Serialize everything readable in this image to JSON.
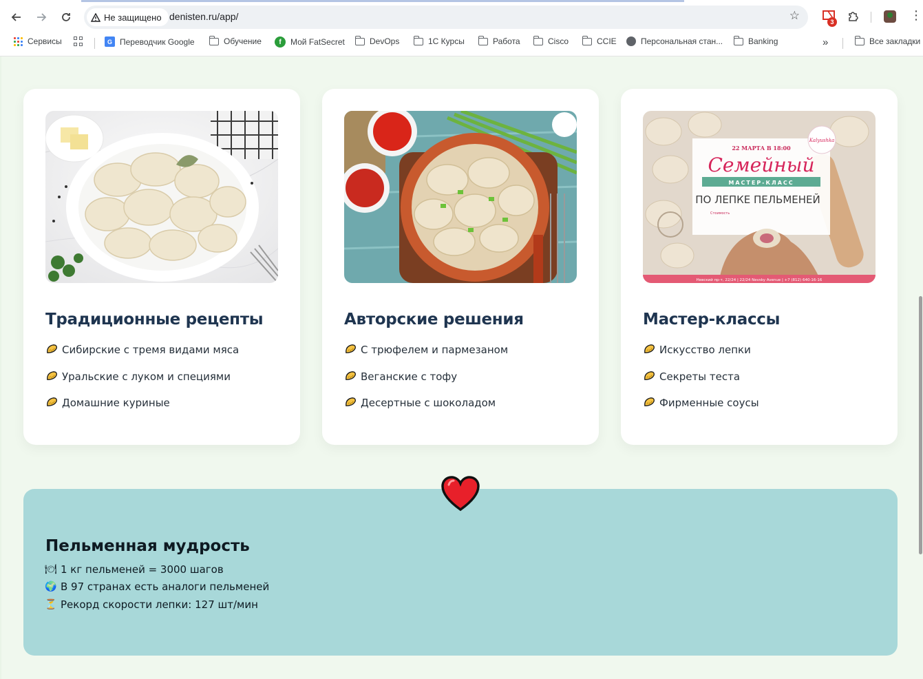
{
  "browser": {
    "security_label": "Не защищено",
    "url": "denisten.ru/app/",
    "gmail_badge": "3",
    "bookmarks": [
      {
        "label": "Сервисы",
        "icon": "apps-grid-icon"
      },
      {
        "label": "",
        "icon": "tab-groups-icon"
      },
      {
        "label": "Переводчик Google",
        "icon": "google-translate-icon"
      },
      {
        "label": "Обучение",
        "icon": "folder-icon"
      },
      {
        "label": "Мой FatSecret",
        "icon": "fatsecret-icon"
      },
      {
        "label": "DevOps",
        "icon": "folder-icon"
      },
      {
        "label": "1С Курсы",
        "icon": "folder-icon"
      },
      {
        "label": "Работа",
        "icon": "folder-icon"
      },
      {
        "label": "Cisco",
        "icon": "folder-icon"
      },
      {
        "label": "CCIE",
        "icon": "folder-icon"
      },
      {
        "label": "Персональная стан...",
        "icon": "globe-icon"
      },
      {
        "label": "Banking",
        "icon": "folder-icon"
      }
    ],
    "more_bookmarks": "»",
    "all_bookmarks": "Все закладки"
  },
  "cards": [
    {
      "title": "Традиционные рецепты",
      "image": "dumplings-plate-photo",
      "items": [
        "Сибирские с тремя видами мяса",
        "Уральские с луком и специями",
        "Домашние куриные"
      ]
    },
    {
      "title": "Авторские решения",
      "image": "dumplings-bowl-photo",
      "items": [
        "С трюфелем и пармезаном",
        "Веганские с тофу",
        "Десертные с шоколадом"
      ]
    },
    {
      "title": "Мастер-классы",
      "image": "masterclass-poster",
      "poster": {
        "date": "22 МАРТА В 18:00",
        "headline": "Семейный",
        "ribbon": "МАСТЕР-КЛАСС",
        "subtitle": "ПО ЛЕПКЕ ПЕЛЬМЕНЕЙ",
        "logo": "Kalyushka",
        "price": "Стоимость",
        "footer": "Невский пр-т, 22/24 | 22/24 Nevsky Avenue | +7 (812) 640-16-16"
      },
      "items": [
        "Искусство лепки",
        "Секреты теста",
        "Фирменные соусы"
      ]
    }
  ],
  "wisdom": {
    "title": "Пельменная мудрость",
    "facts": [
      {
        "icon": "plate-icon",
        "glyph": "🍽",
        "text": "1 кг пельменей = 3000 шагов"
      },
      {
        "icon": "globe-icon",
        "glyph": "🌍",
        "text": "В 97 странах есть аналоги пельменей"
      },
      {
        "icon": "hourglass-icon",
        "glyph": "⏳",
        "text": "Рекорд скорости лепки: 127 шт/мин"
      }
    ]
  },
  "colors": {
    "page_bg": "#f0f8ee",
    "card_title": "#1f3550",
    "wisdom_bg": "#a8d8d9",
    "heart": "#e8202a"
  }
}
